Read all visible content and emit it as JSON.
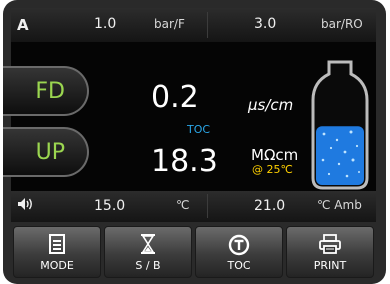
{
  "status_bar": {
    "indicator": "A",
    "feed_pressure": "1.0",
    "feed_pressure_unit": "bar/F",
    "ro_pressure": "3.0",
    "ro_pressure_unit": "bar/RO"
  },
  "mode_buttons": {
    "fd_label": "FD",
    "up_label": "UP"
  },
  "readings": {
    "conductivity_value": "0.2",
    "conductivity_unit": "μs/cm",
    "toc_label": "TOC",
    "resistivity_value": "18.3",
    "resistivity_unit": "MΩcm",
    "reference_temp": "@ 25℃"
  },
  "tank": {
    "level_percent": 55
  },
  "bottom_bar": {
    "speaker_icon": "speaker-icon",
    "water_temp": "15.0",
    "water_temp_unit": "℃",
    "ambient_temp": "21.0",
    "ambient_temp_unit": "℃ Amb"
  },
  "buttons": {
    "mode_label": "MODE",
    "sb_label": "S / B",
    "toc_label": "TOC",
    "print_label": "PRINT"
  },
  "colors": {
    "mode_green": "#9bd650",
    "toc_blue": "#2aa7e8",
    "temp_yellow": "#ffd000",
    "water_blue": "#1f7ae0"
  }
}
